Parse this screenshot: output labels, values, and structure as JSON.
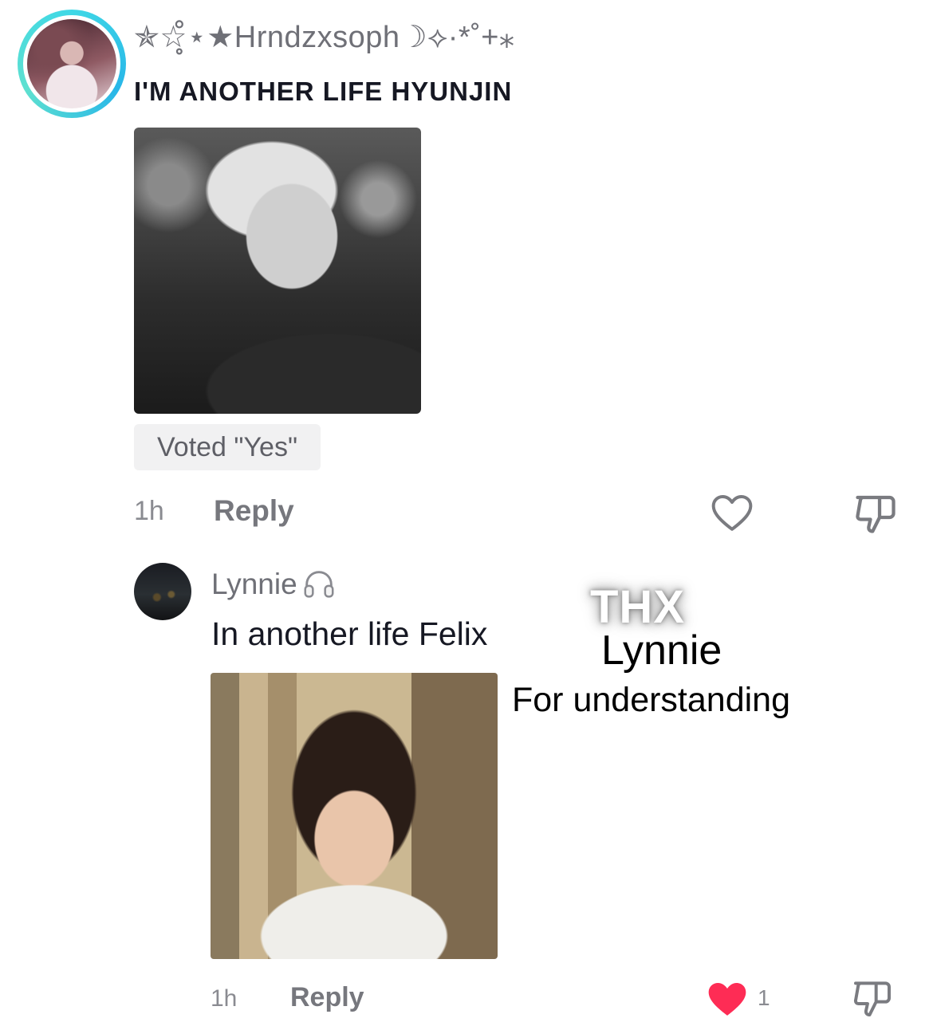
{
  "comment": {
    "username": "✯☆̥̊⋆★Hrndzxsoph☽⟡·*˚+⁎",
    "text": "I'M ANOTHER LIFE HYUNJIN",
    "poll_badge": "Voted \"Yes\"",
    "timestamp": "1h",
    "reply_label": "Reply",
    "like_icon": "heart-outline-icon",
    "dislike_icon": "thumbs-down-icon"
  },
  "reply": {
    "username": "Lynnie",
    "username_emoji_icon": "headphones-icon",
    "text": "In another life Felix",
    "timestamp": "1h",
    "reply_label": "Reply",
    "like_icon": "heart-filled-icon",
    "like_count": "1",
    "dislike_icon": "thumbs-down-icon"
  },
  "overlay": {
    "thanks": "THX",
    "name": "Lynnie",
    "subtitle": "For understanding"
  },
  "colors": {
    "accent_ring": "#3fd8e6",
    "like_filled": "#fe2c55",
    "text_primary": "#161823",
    "text_secondary": "#76777d"
  }
}
